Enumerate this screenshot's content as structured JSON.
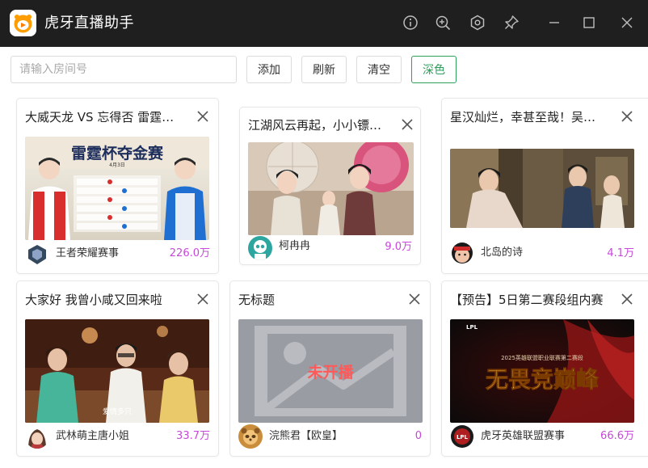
{
  "app": {
    "title": "虎牙直播助手",
    "logo_icon": "huya-logo-icon"
  },
  "titlebar_buttons": [
    "info-icon",
    "zoom-icon",
    "settings-icon",
    "pin-icon",
    "minimize-icon",
    "maximize-icon",
    "close-icon"
  ],
  "toolbar": {
    "room_input_placeholder": "请输入房间号",
    "room_input_value": "",
    "add_label": "添加",
    "refresh_label": "刷新",
    "clear_label": "清空",
    "dark_label": "深色"
  },
  "colors": {
    "titlebar": "#1f1f1f",
    "accent_green": "#2e9e5b",
    "viewer_count": "#c648d8"
  },
  "rooms": [
    {
      "title": "大威天龙 VS 忘得否 雷霆…",
      "streamer": "王者荣耀赛事",
      "viewers": "226.0万",
      "thumb_text": "雷霆杯夺金赛",
      "thumb_date": "4月3日"
    },
    {
      "title": "江湖风云再起，小小镖局…",
      "streamer": "柯冉冉",
      "viewers": "9.0万"
    },
    {
      "title": "星汉灿烂，幸甚至哉！吴…",
      "streamer": "北岛的诗",
      "viewers": "4.1万"
    },
    {
      "title": "大家好 我曾小咸又回来啦",
      "streamer": "武林萌主唐小姐",
      "viewers": "33.7万",
      "thumb_caption": "爱情多只"
    },
    {
      "title": "无标题",
      "streamer": "浣熊君【欧皇】",
      "viewers": "0",
      "thumb_text": "未开播"
    },
    {
      "title": "【预告】5日第二赛段组内赛",
      "streamer": "虎牙英雄联盟赛事",
      "viewers": "66.6万",
      "thumb_text": "无畏竞巅峰",
      "thumb_sub": "2025英雄联盟职业联赛第二赛段",
      "thumb_logo": "LPL"
    }
  ]
}
